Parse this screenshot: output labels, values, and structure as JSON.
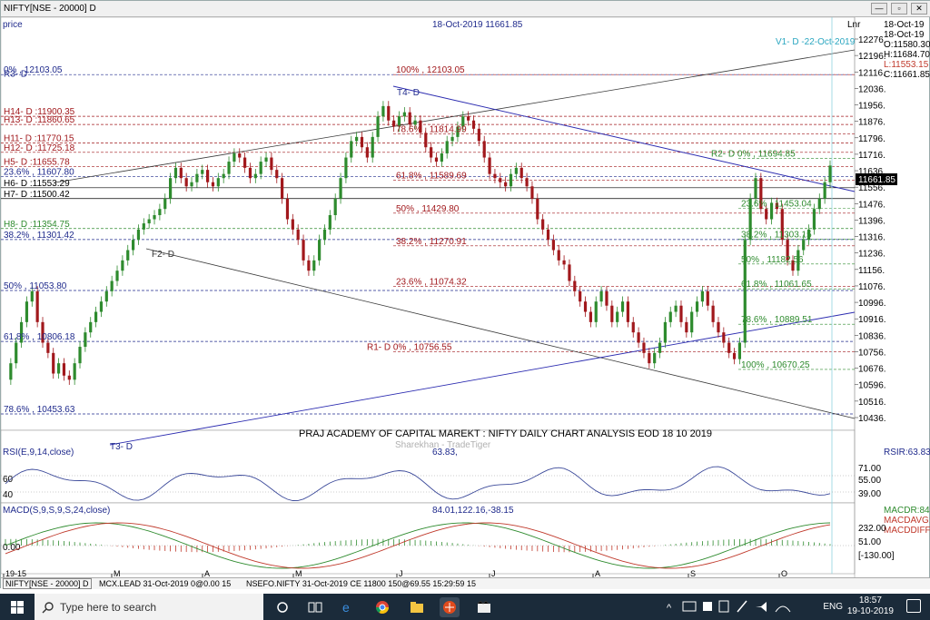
{
  "window": {
    "title": "NIFTY[NSE - 20000] D",
    "buttons": [
      "—",
      "▫",
      "✕"
    ]
  },
  "price_panel": {
    "label": "price",
    "header": "18-Oct-2019 11661.85",
    "linear_label": "Lnr",
    "cursor_label": "V1- D -22-Oct-2019",
    "date_top": "18-Oct-19",
    "ohlc": [
      "18-Oct-19",
      "O:11580.30",
      "H:11684.70",
      "L:11553.15",
      "C:11661.85"
    ],
    "last_price": "11661.85",
    "title": "PRAJ ACADEMY OF CAPITAL MAREKT : NIFTY DAILY CHART ANALYSIS EOD 18 10 2019",
    "watermark": "Sharekhan - TradeTiger",
    "y_ticks": [
      12276,
      12196,
      12116,
      12036,
      11956,
      11876,
      11796,
      11716,
      11636,
      11556,
      11476,
      11396,
      11316,
      11236,
      11156,
      11076,
      10996,
      10916,
      10836,
      10756,
      10676,
      10596,
      10516,
      10436
    ]
  },
  "levels_left": [
    {
      "text": "0%  , 12103.05",
      "price": 12103.05,
      "color": "#1f2a8c",
      "style": "dash"
    },
    {
      "text": "R3- D",
      "price": 12083,
      "color": "#1f2a8c",
      "style": "none"
    },
    {
      "text": "H14- D :11900.35",
      "price": 11900.35,
      "color": "#a1181c",
      "style": "dash"
    },
    {
      "text": "H13- D :11860.65",
      "price": 11860.65,
      "color": "#a1181c",
      "style": "dash"
    },
    {
      "text": "H11- D :11770.15",
      "price": 11770.15,
      "color": "#a1181c",
      "style": "dash"
    },
    {
      "text": "H12- D :11725.18",
      "price": 11725.18,
      "color": "#a1181c",
      "style": "dash"
    },
    {
      "text": "H5- D :11655.78",
      "price": 11655.78,
      "color": "#a1181c",
      "style": "dash"
    },
    {
      "text": "23.6%  , 11607.80",
      "price": 11607.8,
      "color": "#1f2a8c",
      "style": "dash"
    },
    {
      "text": "H6- D :11553.29",
      "price": 11553.29,
      "color": "#000000",
      "style": "solid"
    },
    {
      "text": "H7- D :11500.42",
      "price": 11500.42,
      "color": "#000000",
      "style": "solid"
    },
    {
      "text": "H8- D :11354.75",
      "price": 11354.75,
      "color": "#2e8b2e",
      "style": "dash"
    },
    {
      "text": "38.2%  , 11301.42",
      "price": 11301.42,
      "color": "#1f2a8c",
      "style": "dash"
    },
    {
      "text": "50%  , 11053.80",
      "price": 11053.8,
      "color": "#1f2a8c",
      "style": "dash"
    },
    {
      "text": "61.8%  , 10806.18",
      "price": 10806.18,
      "color": "#1f2a8c",
      "style": "dash"
    },
    {
      "text": "78.6%  , 10453.63",
      "price": 10453.63,
      "color": "#1f2a8c",
      "style": "dash"
    }
  ],
  "levels_mid": [
    {
      "text": "100%  , 12103.05",
      "price": 12103.05
    },
    {
      "text": "78.6%  , 11814.99",
      "price": 11814.99
    },
    {
      "text": "61.8%  , 11589.69",
      "price": 11589.69
    },
    {
      "text": "50%  , 11429.80",
      "price": 11429.8
    },
    {
      "text": "38.2%  , 11270.91",
      "price": 11270.91
    },
    {
      "text": "23.6%  , 11074.32",
      "price": 11074.32
    },
    {
      "text": "R1- D  0%  , 10756.55",
      "price": 10756.55
    }
  ],
  "levels_right": [
    {
      "text": "R2- D  0%  , 11694.85",
      "price": 11694.85
    },
    {
      "text": "23.6%  , 11453.04",
      "price": 11453.04
    },
    {
      "text": "38.2%  , 11303.15",
      "price": 11303.15
    },
    {
      "text": "50%  , 11182.56",
      "price": 11182.56
    },
    {
      "text": "61.8%  , 11061.65",
      "price": 11061.65
    },
    {
      "text": "78.6%  , 10889.51",
      "price": 10889.51
    },
    {
      "text": "100%  , 10670.25",
      "price": 10670.25
    }
  ],
  "trend_labels": {
    "t4": "T4- D",
    "f2": "F2- D",
    "t3": "T3- D"
  },
  "rsi_panel": {
    "label": "RSI(E,9,14,close)",
    "value": "63.83,",
    "right_label": "RSIR:63.83",
    "left_ticks": [
      "60",
      "40"
    ],
    "right_ticks": [
      "71.00",
      "55.00",
      "39.00"
    ]
  },
  "macd_panel": {
    "label": "MACD(S,9,S,9,S,24,close)",
    "values": "84.01,122.16,-38.15",
    "right_labels": [
      "MACDR:84.",
      "MACDAVG:",
      "MACDDIFF:"
    ],
    "left_tick": "0.00",
    "right_ticks": [
      "232.00",
      "51.00",
      "[-130.00]"
    ]
  },
  "x_axis": [
    "19-15",
    "M",
    "A",
    "M",
    "J",
    "J",
    "A",
    "S",
    "O"
  ],
  "statusbar": {
    "item1": "NIFTY[NSE - 20000] D",
    "item2": "MCX.LEAD 31-Oct-2019 0@0.00  15",
    "item3": "NSEFO.NIFTY 31-Oct-2019 CE 11800 150@69.55 15:29:59 15"
  },
  "taskbar": {
    "search_placeholder": "Type here to search",
    "lang": "ENG",
    "time": "18:57",
    "date": "19-10-2019"
  },
  "colors": {
    "bull": "#2e8b2e",
    "bear": "#a1181c",
    "blue": "#1f2a8c",
    "green": "#2e8b2e",
    "red": "#c0392b"
  }
}
